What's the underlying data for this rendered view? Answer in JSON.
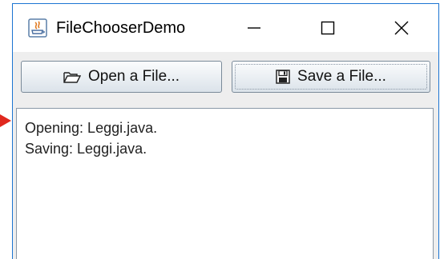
{
  "window": {
    "title": "FileChooserDemo"
  },
  "toolbar": {
    "open_label": "Open a File...",
    "save_label": "Save a File..."
  },
  "log": {
    "lines": [
      "Opening: Leggi.java.",
      "Saving: Leggi.java."
    ]
  },
  "icons": {
    "app": "java-app-icon",
    "minimize": "minimize-icon",
    "maximize": "maximize-icon",
    "close": "close-icon",
    "open": "folder-open-icon",
    "save": "floppy-disk-icon"
  },
  "colors": {
    "window_border": "#1c74d2",
    "pointer": "#e0281e"
  }
}
